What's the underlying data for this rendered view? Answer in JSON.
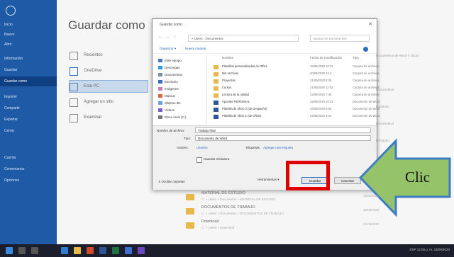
{
  "backstage": {
    "title": "Guardar como",
    "rail": {
      "back": "←",
      "items": [
        "Inicio",
        "Nuevo",
        "Abrir",
        "Información",
        "Guardar",
        "Guardar como",
        "Imprimir",
        "Compartir",
        "Exportar",
        "Cerrar",
        "Cuenta",
        "Comentarios",
        "Opciones"
      ],
      "active_index": 5
    },
    "locations": [
      "Recientes",
      "OneDrive",
      "Este PC",
      "Agregar un sitio",
      "Examinar"
    ],
    "selected_location": 2,
    "right_column": [
      "Documentos de Word (*.docx)",
      "Documentos",
      "Escritorio",
      "Documentos",
      "Escritorio"
    ],
    "recent_folders": [
      {
        "name": "MATERIAL DE ESTUDIO",
        "path": "C: » Users » Documents » MATERIAL DE ESTUDIO",
        "date": "23/09/2020"
      },
      {
        "name": "DOCUMENTOS DE TRABAJO",
        "path": "C: » Users » Documents » DOCUMENTOS DE TRABAJO",
        "date": "22/09/2020"
      },
      {
        "name": "Download",
        "path": "C: » Users » Download",
        "date": "21/09/2020"
      }
    ]
  },
  "dialog": {
    "title": "Guardar como",
    "close": "✕",
    "address": "« Users › Documentos",
    "search_placeholder": "Buscar en Documentos",
    "toolbar": {
      "organize": "Organizar ▾",
      "new_folder": "Nueva carpeta"
    },
    "nav_items": [
      "Este equipo",
      "Descargas",
      "Documentos",
      "Escritorio",
      "Imágenes",
      "Música",
      "Objetos 3D",
      "Vídeos",
      "Disco local (C:)"
    ],
    "columns": [
      "Nombre",
      "Fecha de modificación",
      "Tipo"
    ],
    "files": [
      {
        "name": "Plantillas personalizadas de Office",
        "date": "15/09/2020 10:22",
        "type": "Carpeta de archivos"
      },
      {
        "name": "Mis archivos",
        "date": "20/09/2020 9:14",
        "type": "Carpeta de archivos"
      },
      {
        "name": "Proyectos",
        "date": "21/09/2020 8:35",
        "type": "Carpeta de archivos"
      },
      {
        "name": "Cursos",
        "date": "21/09/2020 11:02",
        "type": "Carpeta de archivos"
      },
      {
        "name": "Lectura de la unidad",
        "date": "22/09/2020 7:48",
        "type": "Carpeta de archivos"
      },
      {
        "name": "Apuntes PERSONAL",
        "date": "22/09/2020 10:31",
        "type": "Documento de Word"
      },
      {
        "name": "Plantilla de oficio 2 (de Despacho)",
        "date": "23/09/2020 9:05",
        "type": "Documento de Word"
      },
      {
        "name": "Plantilla de oficio 1 (de Oficio)",
        "date": "23/09/2020 9:26",
        "type": "Documento de Word"
      }
    ],
    "form": {
      "filename_label": "Nombre de archivo:",
      "filename_value": "Trabajo final",
      "type_label": "Tipo:",
      "type_value": "Documento de Word",
      "authors_label": "Autores:",
      "authors_value": "Usuario",
      "tags_label": "Etiquetas:",
      "tags_value": "Agregar una etiqueta",
      "thumbnail_label": "Guardar miniatura",
      "hide_folders": "∧ Ocultar carpetas",
      "tools": "Herramientas ▾",
      "save": "Guardar",
      "cancel": "Cancelar"
    }
  },
  "annotation": {
    "label": "Clic",
    "arrow_fill": "#95c36a",
    "arrow_stroke": "#3e7bc4",
    "highlight_color": "#e00000"
  },
  "taskbar": {
    "tray_text": "ESP  12:05 p. m.  23/09/2020"
  },
  "colors": {
    "accent": "#1f5aa6",
    "rail_active": "#0e3f83",
    "folder": "#e7b94a"
  }
}
